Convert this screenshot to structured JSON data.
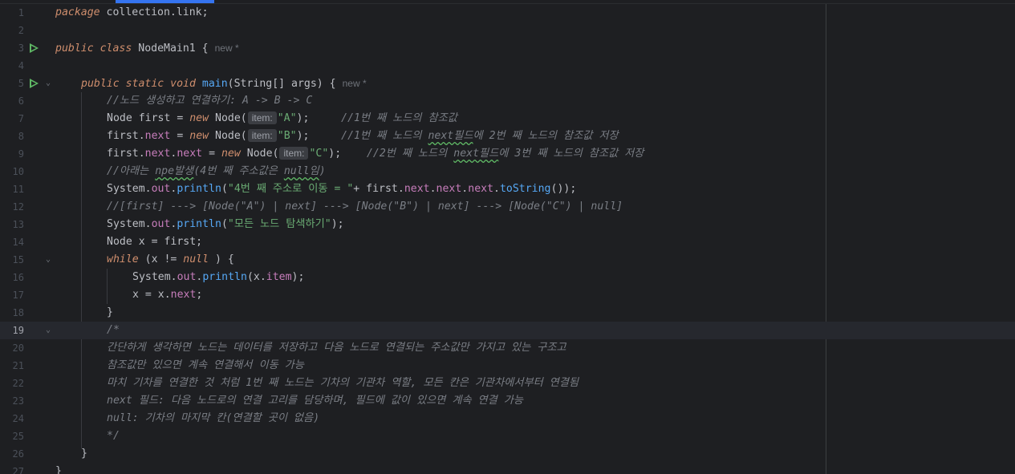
{
  "editor": {
    "lines": [
      {
        "n": "1",
        "segs": [
          [
            "kw",
            "package"
          ],
          [
            "",
            "collection.link;"
          ]
        ]
      },
      {
        "n": "2",
        "segs": []
      },
      {
        "n": "3",
        "segs": [
          [
            "kw",
            "public"
          ],
          [
            "kw",
            "class"
          ],
          [
            "",
            "NodeMain1 {"
          ]
        ],
        "author": "new *"
      },
      {
        "n": "4",
        "segs": []
      },
      {
        "n": "5",
        "segs": [
          [
            "kw",
            "public static void"
          ],
          [
            "fn",
            "main"
          ],
          [
            "",
            "(String[] args) {"
          ]
        ],
        "author": "new *"
      },
      {
        "n": "6",
        "segs": [
          [
            "cm",
            "//노드 생성하고 연결하기: A -> B -> C"
          ]
        ]
      },
      {
        "n": "7",
        "segs": [
          [
            "",
            "Node first = "
          ],
          [
            "kw",
            "new"
          ],
          [
            "",
            "Node("
          ],
          [
            "hint",
            "item:"
          ],
          [
            "str",
            "\"A\""
          ],
          [
            "",
            ");"
          ],
          [
            "cm",
            "//1번 째 노드의 참조값"
          ]
        ]
      },
      {
        "n": "8",
        "segs": [
          [
            "",
            "first."
          ],
          [
            "field",
            "next"
          ],
          [
            "",
            "= "
          ],
          [
            "kw",
            "new"
          ],
          [
            "",
            "Node("
          ],
          [
            "hint",
            "item:"
          ],
          [
            "str",
            "\"B\""
          ],
          [
            "",
            ");"
          ],
          [
            "cm",
            "//1번 째 노드의 next필드에 2번 째 노드의 참조값 저장"
          ]
        ]
      },
      {
        "n": "9",
        "segs": [
          [
            "",
            "first."
          ],
          [
            "field",
            "next"
          ],
          [
            "",
            "."
          ],
          [
            "field",
            "next"
          ],
          [
            "",
            "= "
          ],
          [
            "kw",
            "new"
          ],
          [
            "",
            "Node("
          ],
          [
            "hint",
            "item:"
          ],
          [
            "str",
            "\"C\""
          ],
          [
            "",
            ");"
          ],
          [
            "cm",
            "//2번 째 노드의 next필드에 3번 째 노드의 참조값 저장"
          ]
        ]
      },
      {
        "n": "10",
        "segs": [
          [
            "cm",
            "//아래는 npe발생(4번 째 주소값은 null임)"
          ]
        ]
      },
      {
        "n": "11",
        "segs": [
          [
            "",
            "System."
          ],
          [
            "field",
            "out"
          ],
          [
            "",
            "."
          ],
          [
            "fn",
            "println"
          ],
          [
            "",
            "("
          ],
          [
            "str",
            "\"4번 째 주소로 이동 = \""
          ],
          [
            "",
            "+ first."
          ],
          [
            "field",
            "next"
          ],
          [
            "",
            "."
          ],
          [
            "field",
            "next"
          ],
          [
            "",
            "."
          ],
          [
            "field",
            "next"
          ],
          [
            "",
            "."
          ],
          [
            "fn",
            "toString"
          ],
          [
            "",
            "());"
          ]
        ]
      },
      {
        "n": "12",
        "segs": [
          [
            "cm",
            "//[first] ---> [Node(\"A\") | next] ---> [Node(\"B\") | next] ---> [Node(\"C\") | null]"
          ]
        ]
      },
      {
        "n": "13",
        "segs": [
          [
            "",
            "System."
          ],
          [
            "field",
            "out"
          ],
          [
            "",
            "."
          ],
          [
            "fn",
            "println"
          ],
          [
            "",
            "("
          ],
          [
            "str",
            "\"모든 노드 탐색하기\""
          ],
          [
            "",
            ");"
          ]
        ]
      },
      {
        "n": "14",
        "segs": [
          [
            "",
            "Node x = first;"
          ]
        ]
      },
      {
        "n": "15",
        "segs": [
          [
            "kw",
            "while"
          ],
          [
            "",
            "(x != "
          ],
          [
            "kw",
            "null"
          ],
          [
            "",
            ") {"
          ]
        ]
      },
      {
        "n": "16",
        "segs": [
          [
            "",
            "System."
          ],
          [
            "field",
            "out"
          ],
          [
            "",
            "."
          ],
          [
            "fn",
            "println"
          ],
          [
            "",
            "(x."
          ],
          [
            "field",
            "item"
          ],
          [
            "",
            ");"
          ]
        ]
      },
      {
        "n": "17",
        "segs": [
          [
            "",
            "x = x."
          ],
          [
            "field",
            "next"
          ],
          [
            "",
            ";"
          ]
        ]
      },
      {
        "n": "18",
        "segs": [
          [
            "",
            "}"
          ]
        ]
      },
      {
        "n": "19",
        "segs": [
          [
            "cm",
            "/*"
          ]
        ]
      },
      {
        "n": "20",
        "segs": [
          [
            "cm",
            "간단하게 생각하면 노드는 데이터를 저장하고 다음 노드로 연결되는 주소값만 가지고 있는 구조고"
          ]
        ]
      },
      {
        "n": "21",
        "segs": [
          [
            "cm",
            "참조값만 있으면 계속 연결해서 이동 가능"
          ]
        ]
      },
      {
        "n": "22",
        "segs": [
          [
            "cm",
            "마치 기차를 연결한 것 처럼 1번 째 노드는 기차의 기관차 역할, 모든 칸은 기관차에서부터 연결됨"
          ]
        ]
      },
      {
        "n": "23",
        "segs": [
          [
            "cm",
            "next 필드: 다음 노드로의 연결 고리를 담당하며, 필드에 값이 있으면 계속 연결 가능"
          ]
        ]
      },
      {
        "n": "24",
        "segs": [
          [
            "cm",
            "null: 기차의 마지막 칸(연결할 곳이 없음)"
          ]
        ]
      },
      {
        "n": "25",
        "segs": [
          [
            "cm",
            "*/"
          ]
        ]
      },
      {
        "n": "26",
        "segs": [
          [
            "",
            "}"
          ]
        ]
      },
      {
        "n": "27",
        "segs": [
          [
            "",
            "}"
          ]
        ]
      }
    ]
  }
}
